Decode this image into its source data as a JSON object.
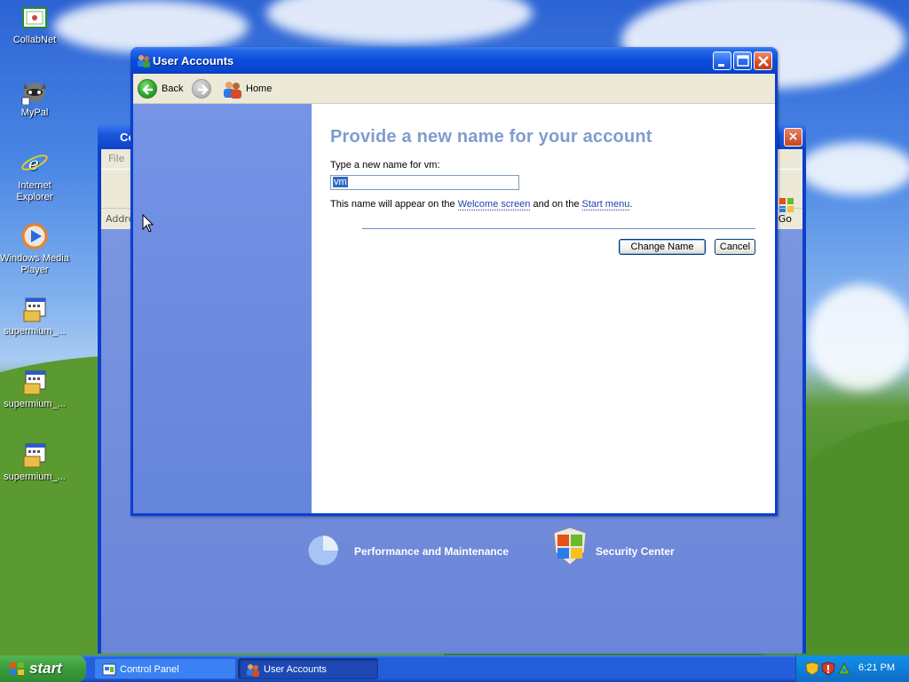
{
  "desktop": {
    "icons": [
      {
        "label": "CollabNet"
      },
      {
        "label": "MyPal"
      },
      {
        "label": "Internet Explorer"
      },
      {
        "label": "Windows Media Player"
      },
      {
        "label": "supermium_..."
      },
      {
        "label": "supermium_..."
      },
      {
        "label": "supermium_..."
      }
    ]
  },
  "control_panel": {
    "title_fragment": "Co",
    "menu_file": "File",
    "address_label": "Addre",
    "go_label": "Go",
    "categories": [
      {
        "label": "Performance and Maintenance"
      },
      {
        "label": "Security Center"
      }
    ]
  },
  "user_accounts": {
    "title": "User Accounts",
    "toolbar": {
      "back_label": "Back",
      "home_label": "Home"
    },
    "heading": "Provide a new name for your account",
    "prompt": "Type a new name for vm:",
    "name_value": "vm",
    "info_prefix": "This name will appear on the ",
    "info_link1": "Welcome screen",
    "info_middle": " and on the ",
    "info_link2": "Start menu",
    "info_suffix": ".",
    "buttons": {
      "change_name": "Change Name",
      "cancel": "Cancel"
    }
  },
  "taskbar": {
    "start_label": "start",
    "tasks": [
      {
        "label": "Control Panel"
      },
      {
        "label": "User Accounts"
      }
    ],
    "clock": "6:21 PM"
  },
  "colors": {
    "title_bar": "#0a4ddc",
    "heading": "#7f9ccd",
    "left_pane": "#6d8ce0",
    "link": "#1f3fb0",
    "selection": "#316ac5"
  }
}
